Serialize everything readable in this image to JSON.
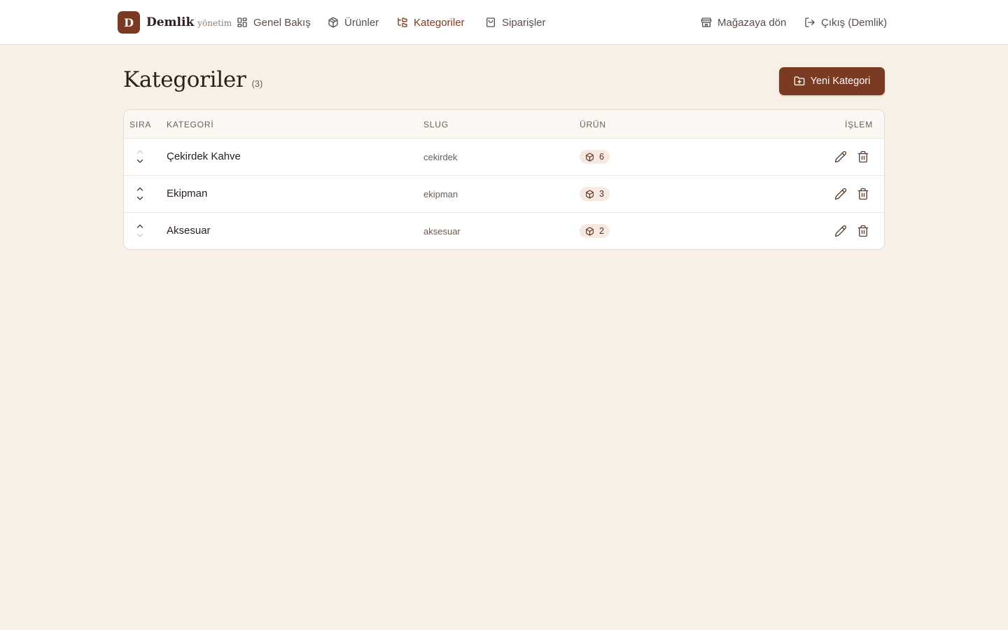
{
  "brand": {
    "logo_letter": "D",
    "name": "Demlik",
    "subtitle": "yönetim"
  },
  "nav": {
    "overview": "Genel Bakış",
    "products": "Ürünler",
    "categories": "Kategoriler",
    "orders": "Siparişler",
    "store": "Mağazaya dön",
    "logout": "Çıkış (Demlik)"
  },
  "page": {
    "title": "Kategoriler",
    "count": "(3)",
    "new_button": "Yeni Kategori"
  },
  "table": {
    "headers": {
      "order": "SIRA",
      "category": "KATEGORİ",
      "slug": "SLUG",
      "products": "ÜRÜN",
      "actions": "İŞLEM"
    },
    "rows": [
      {
        "name": "Çekirdek Kahve",
        "slug": "cekirdek",
        "count": "6"
      },
      {
        "name": "Ekipman",
        "slug": "ekipman",
        "count": "3"
      },
      {
        "name": "Aksesuar",
        "slug": "aksesuar",
        "count": "2"
      }
    ]
  },
  "colors": {
    "accent": "#7b3a22",
    "background": "#f8f0e7",
    "badge_bg": "#f6e9e2"
  },
  "icons": {
    "overview": "layout-grid-icon",
    "products": "package-icon",
    "categories": "folder-tree-icon",
    "orders": "shopping-bag-icon",
    "store": "store-icon",
    "logout": "log-out-icon",
    "new": "folder-plus-icon",
    "edit": "pencil-icon",
    "delete": "trash-icon"
  }
}
